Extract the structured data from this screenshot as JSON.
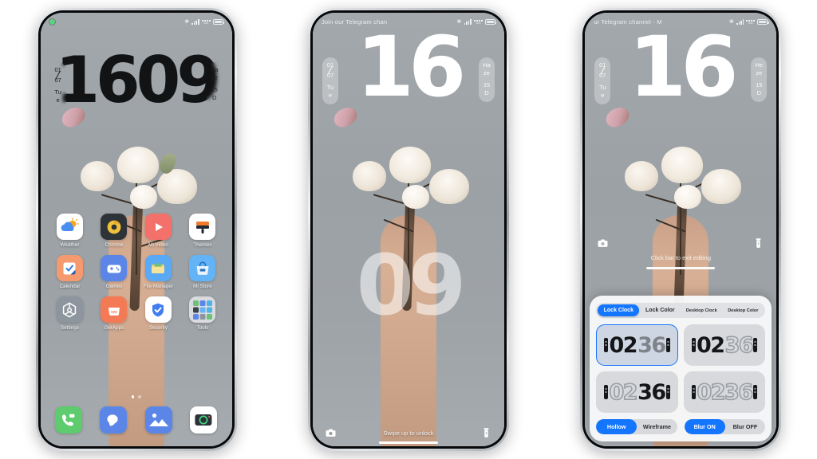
{
  "meta": {
    "accent": "#1475ff",
    "screen_bg": "#9da2a6",
    "clock_dark": "#111315",
    "clock_light": "#ffffff"
  },
  "statusbar": {
    "bluetooth_icon": "bluetooth-icon",
    "signal_icon": "signal-bars-icon",
    "wifi_label": "WIFI",
    "battery_icon": "battery-icon",
    "camera_dot": "front-camera-dot"
  },
  "phone1": {
    "name": "home-screen",
    "clock": {
      "digits": [
        "1",
        "6",
        "0",
        "9"
      ],
      "value": "1609"
    },
    "date_pill": {
      "day": "01",
      "month": "07",
      "weekday_line1": "Tu",
      "weekday_line2": "e"
    },
    "weather_pill": {
      "cond_line1": "Ha",
      "cond_line2": "ze",
      "temp_line1": "15",
      "temp_line2": "D"
    },
    "apps": [
      {
        "label": "Weather",
        "icon": "weather-icon"
      },
      {
        "label": "Chrome",
        "icon": "chrome-icon"
      },
      {
        "label": "Mi Video",
        "icon": "mi-video-icon"
      },
      {
        "label": "Themes",
        "icon": "themes-icon"
      },
      {
        "label": "Calendar",
        "icon": "calendar-icon"
      },
      {
        "label": "Games",
        "icon": "games-icon"
      },
      {
        "label": "File Manager",
        "icon": "file-manager-icon"
      },
      {
        "label": "Mi Store",
        "icon": "mi-store-icon"
      },
      {
        "label": "Settings",
        "icon": "settings-icon"
      },
      {
        "label": "GetApps",
        "icon": "getapps-icon"
      },
      {
        "label": "Security",
        "icon": "security-icon"
      },
      {
        "label": "Tools",
        "icon": "tools-folder-icon"
      }
    ],
    "page_dots": {
      "total": 2,
      "active_index": 0
    },
    "dock": [
      {
        "label": "Phone",
        "icon": "phone-icon"
      },
      {
        "label": "Messages",
        "icon": "messages-icon"
      },
      {
        "label": "Gallery",
        "icon": "gallery-icon"
      },
      {
        "label": "Camera",
        "icon": "camera-icon"
      }
    ]
  },
  "phone2": {
    "name": "lock-screen",
    "banner": "Join our Telegram chan",
    "clock": {
      "top": "16",
      "bottom": "09"
    },
    "date_pill": {
      "day": "01",
      "month": "07",
      "weekday_line1": "Tu",
      "weekday_line2": "e"
    },
    "weather_pill": {
      "cond_line1": "Ha",
      "cond_line2": "ze",
      "temp_line1": "15",
      "temp_line2": "D"
    },
    "swipe_hint": "Swipe up to unlock",
    "camera_icon": "camera-icon",
    "flashlight_icon": "flashlight-icon"
  },
  "phone3": {
    "name": "clock-editor",
    "banner": "ur Telegram channel - M",
    "clock": {
      "top": "16"
    },
    "date_pill": {
      "day": "01",
      "month": "07",
      "weekday_line1": "Tu",
      "weekday_line2": "e"
    },
    "weather_pill": {
      "cond_line1": "He",
      "cond_line2": "ze",
      "temp_line1": "15",
      "temp_line2": "D"
    },
    "exit_hint": "Click bar to exit editing",
    "camera_icon": "camera-icon",
    "flashlight_icon": "flashlight-icon",
    "panel": {
      "tabs": [
        {
          "label": "Lock Clock",
          "active": true
        },
        {
          "label": "Lock Color",
          "active": false
        },
        {
          "label": "Desktop Clock",
          "active": false
        },
        {
          "label": "Desktop Color",
          "active": false
        }
      ],
      "style_cards": [
        {
          "value": "0236",
          "style": "solid",
          "selected": true
        },
        {
          "value": "0236",
          "style": "solid-light",
          "selected": false
        },
        {
          "value": "0236",
          "style": "hollow-dark",
          "selected": false
        },
        {
          "value": "0236",
          "style": "hollow-light",
          "selected": false
        }
      ],
      "segment_style": [
        {
          "label": "Hollow",
          "on": true
        },
        {
          "label": "Wireframe",
          "on": false
        }
      ],
      "segment_blur": [
        {
          "label": "Blur ON",
          "on": true
        },
        {
          "label": "Blur OFF",
          "on": false
        }
      ]
    }
  }
}
